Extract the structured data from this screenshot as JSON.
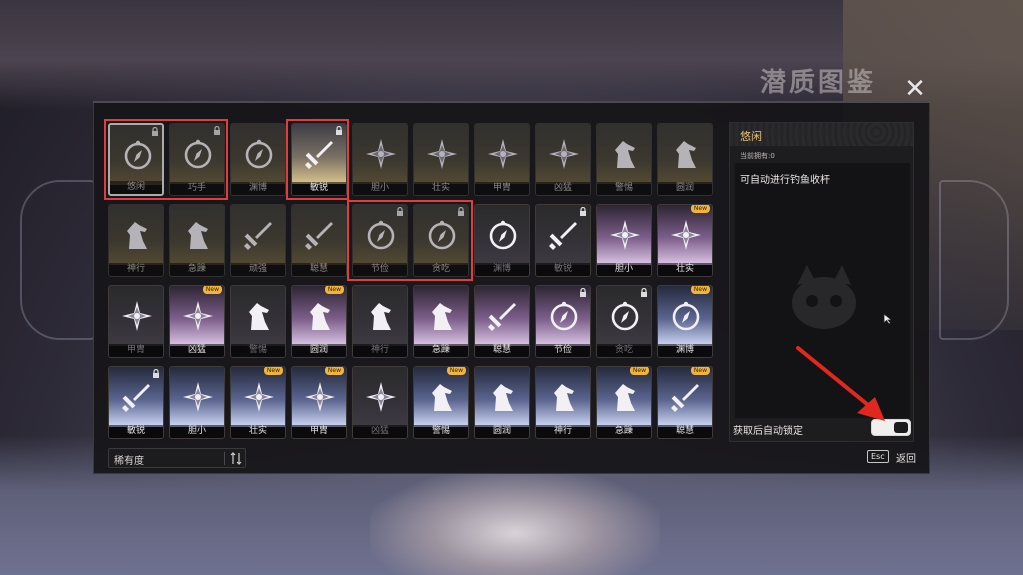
{
  "window": {
    "title": "潜质图鉴",
    "close_icon": "close-icon"
  },
  "cards": [
    {
      "label": "悠闲",
      "icon": "compass",
      "style": "dull",
      "lock": true,
      "new": false,
      "selected": true
    },
    {
      "label": "巧手",
      "icon": "compass",
      "style": "dull",
      "lock": true,
      "new": false,
      "selected": false
    },
    {
      "label": "渊博",
      "icon": "compass",
      "style": "dull",
      "lock": false,
      "new": false,
      "selected": false
    },
    {
      "label": "敏锐",
      "icon": "sword",
      "style": "gold",
      "lock": true,
      "new": false,
      "selected": false
    },
    {
      "label": "胆小",
      "icon": "star",
      "style": "dull",
      "lock": false,
      "new": false,
      "selected": false
    },
    {
      "label": "壮实",
      "icon": "star",
      "style": "dull",
      "lock": false,
      "new": false,
      "selected": false
    },
    {
      "label": "甲胄",
      "icon": "star",
      "style": "dull",
      "lock": false,
      "new": false,
      "selected": false
    },
    {
      "label": "凶猛",
      "icon": "star",
      "style": "dull",
      "lock": false,
      "new": false,
      "selected": false
    },
    {
      "label": "警惕",
      "icon": "horse",
      "style": "dull",
      "lock": false,
      "new": false,
      "selected": false
    },
    {
      "label": "圆润",
      "icon": "horse",
      "style": "dull",
      "lock": false,
      "new": false,
      "selected": false
    },
    {
      "label": "神行",
      "icon": "horse",
      "style": "dull",
      "lock": false,
      "new": false,
      "selected": false
    },
    {
      "label": "急躁",
      "icon": "horse",
      "style": "dull",
      "lock": false,
      "new": false,
      "selected": false
    },
    {
      "label": "顽强",
      "icon": "sword",
      "style": "dull",
      "lock": false,
      "new": false,
      "selected": false
    },
    {
      "label": "聪慧",
      "icon": "sword",
      "style": "dull",
      "lock": false,
      "new": false,
      "selected": false
    },
    {
      "label": "节俭",
      "icon": "compass",
      "style": "dull",
      "lock": true,
      "new": false,
      "selected": false
    },
    {
      "label": "贪吃",
      "icon": "compass",
      "style": "dull",
      "lock": true,
      "new": false,
      "selected": false
    },
    {
      "label": "渊博",
      "icon": "compass",
      "style": "dim",
      "lock": false,
      "new": false,
      "selected": false
    },
    {
      "label": "敏锐",
      "icon": "sword",
      "style": "dim",
      "lock": true,
      "new": false,
      "selected": false
    },
    {
      "label": "胆小",
      "icon": "star",
      "style": "pink",
      "lock": false,
      "new": false,
      "selected": false
    },
    {
      "label": "壮实",
      "icon": "star",
      "style": "pink",
      "lock": false,
      "new": true,
      "selected": false
    },
    {
      "label": "甲胄",
      "icon": "star",
      "style": "dim",
      "lock": false,
      "new": false,
      "selected": false
    },
    {
      "label": "凶猛",
      "icon": "star",
      "style": "pink",
      "lock": false,
      "new": true,
      "selected": false
    },
    {
      "label": "警惕",
      "icon": "horse",
      "style": "dim",
      "lock": false,
      "new": false,
      "selected": false
    },
    {
      "label": "圆润",
      "icon": "horse",
      "style": "pink",
      "lock": false,
      "new": true,
      "selected": false
    },
    {
      "label": "神行",
      "icon": "horse",
      "style": "dim",
      "lock": false,
      "new": false,
      "selected": false
    },
    {
      "label": "急躁",
      "icon": "horse",
      "style": "pink",
      "lock": false,
      "new": false,
      "selected": false
    },
    {
      "label": "聪慧",
      "icon": "sword",
      "style": "pink",
      "lock": false,
      "new": false,
      "selected": false
    },
    {
      "label": "节俭",
      "icon": "compass",
      "style": "pink",
      "lock": true,
      "new": false,
      "selected": false
    },
    {
      "label": "贪吃",
      "icon": "compass",
      "style": "dim",
      "lock": true,
      "new": false,
      "selected": false
    },
    {
      "label": "渊博",
      "icon": "compass",
      "style": "blue",
      "lock": false,
      "new": true,
      "selected": false
    },
    {
      "label": "敏锐",
      "icon": "sword",
      "style": "blue",
      "lock": true,
      "new": false,
      "selected": false
    },
    {
      "label": "胆小",
      "icon": "star",
      "style": "blue",
      "lock": false,
      "new": false,
      "selected": false
    },
    {
      "label": "壮实",
      "icon": "star",
      "style": "blue",
      "lock": false,
      "new": true,
      "selected": false
    },
    {
      "label": "甲胄",
      "icon": "star",
      "style": "blue",
      "lock": false,
      "new": true,
      "selected": false
    },
    {
      "label": "凶猛",
      "icon": "star",
      "style": "dim",
      "lock": false,
      "new": false,
      "selected": false
    },
    {
      "label": "警惕",
      "icon": "horse",
      "style": "blue",
      "lock": false,
      "new": true,
      "selected": false
    },
    {
      "label": "圆润",
      "icon": "horse",
      "style": "blue",
      "lock": false,
      "new": false,
      "selected": false
    },
    {
      "label": "神行",
      "icon": "horse",
      "style": "blue",
      "lock": false,
      "new": false,
      "selected": false
    },
    {
      "label": "急躁",
      "icon": "horse",
      "style": "blue",
      "lock": false,
      "new": true,
      "selected": false
    },
    {
      "label": "聪慧",
      "icon": "sword",
      "style": "blue",
      "lock": false,
      "new": true,
      "selected": false
    }
  ],
  "new_badge": "New",
  "detail": {
    "title": "悠闲",
    "owned_label": "当前拥有:0",
    "description": "可自动进行钓鱼收杆"
  },
  "auto_lock": {
    "label": "获取后自动锁定",
    "enabled": true
  },
  "sort": {
    "label": "稀有度",
    "icon": "sort-icon"
  },
  "footer": {
    "esc_key": "Esc",
    "back_label": "返回"
  },
  "colors": {
    "highlight": "#e23d3d",
    "accent": "#e8c27a",
    "new_badge": "#f0b43c"
  }
}
